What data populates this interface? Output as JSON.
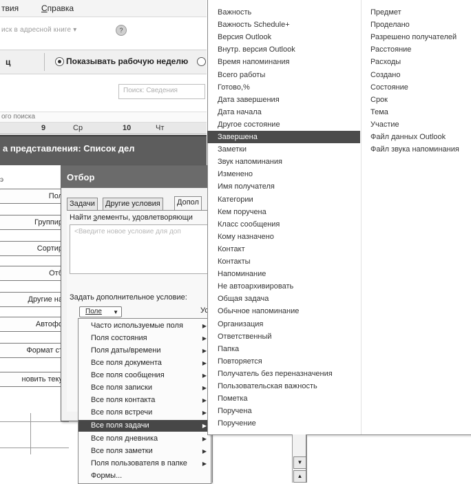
{
  "menubar": {
    "item1": "твия",
    "item2_first": "С",
    "item2_rest": "правка"
  },
  "address": {
    "hint": "иск в адресной книге ▾",
    "help": "?"
  },
  "toolbar": {
    "label_a": "ц",
    "show_workweek": "Показывать рабочую неделю"
  },
  "search": {
    "placeholder": "Поиск: Сведения"
  },
  "search_strip": {
    "text": "ого поиска"
  },
  "dates": {
    "d1": "9",
    "d2": "Ср",
    "d3": "10",
    "d4": "Чт"
  },
  "view_bar": {
    "title": "а представления: Список дел"
  },
  "left_buttons": [
    "Пол",
    "Группир",
    "Сортир",
    "Отб",
    "Другие на",
    "Автофо",
    "Формат ст",
    "новить теку"
  ],
  "sliver_text": "э",
  "dialog": {
    "title": "Отбор",
    "tabs": [
      "Задачи",
      "Другие условия",
      "Допол"
    ],
    "find_prefix": "Найти ",
    "find_underlined": "э",
    "find_rest": "лементы, удовлетворяющи",
    "textarea_placeholder": "<Введите новое условие для доп",
    "add_condition_label": "Задать дополнительное условие:",
    "field_button": "Поле",
    "condition_label": "Ус"
  },
  "submenu": [
    {
      "label": "Часто используемые поля",
      "arrow": true,
      "highlight": false
    },
    {
      "label": "Поля состояния",
      "arrow": true,
      "highlight": false
    },
    {
      "label": "Поля даты/времени",
      "arrow": true,
      "highlight": false
    },
    {
      "label": "Все поля документа",
      "arrow": true,
      "highlight": false
    },
    {
      "label": "Все поля сообщения",
      "arrow": true,
      "highlight": false
    },
    {
      "label": "Все поля записки",
      "arrow": true,
      "highlight": false
    },
    {
      "label": "Все поля контакта",
      "arrow": true,
      "highlight": false
    },
    {
      "label": "Все поля встречи",
      "arrow": true,
      "highlight": false
    },
    {
      "label": "Все поля задачи",
      "arrow": true,
      "highlight": true
    },
    {
      "label": "Все поля дневника",
      "arrow": true,
      "highlight": false
    },
    {
      "label": "Все поля заметки",
      "arrow": true,
      "highlight": false
    },
    {
      "label": "Поля пользователя в папке",
      "arrow": true,
      "highlight": false
    },
    {
      "label": "Формы...",
      "arrow": false,
      "highlight": false
    }
  ],
  "field_list_col1": [
    "Важность",
    "Важность Schedule+",
    "Версия Outlook",
    "Внутр. версия Outlook",
    "Время напоминания",
    "Всего работы",
    "Готово,%",
    "Дата завершения",
    "Дата начала",
    "Другое состояние",
    "Завершена",
    "Заметки",
    "Звук напоминания",
    "Изменено",
    "Имя получателя",
    "Категории",
    "Кем поручена",
    "Класс сообщения",
    "Кому назначено",
    "Контакт",
    "Контакты",
    "Напоминание",
    "Не автоархивировать",
    "Общая задача",
    "Обычное напоминание",
    "Организация",
    "Ответственный",
    "Папка",
    "Повторяется",
    "Получатель без переназначения",
    "Пользовательская важность",
    "Пометка",
    "Поручена",
    "Поручение"
  ],
  "field_list_col1_selected": "Завершена",
  "field_list_col2": [
    "Предмет",
    "Проделано",
    "Разрешено получателей",
    "Расстояние",
    "Расходы",
    "Создано",
    "Состояние",
    "Срок",
    "Тема",
    "Участие",
    "Файл данных Outlook",
    "Файл звука напоминания"
  ],
  "scrollbar": {
    "up": "▲",
    "down": "▼"
  }
}
